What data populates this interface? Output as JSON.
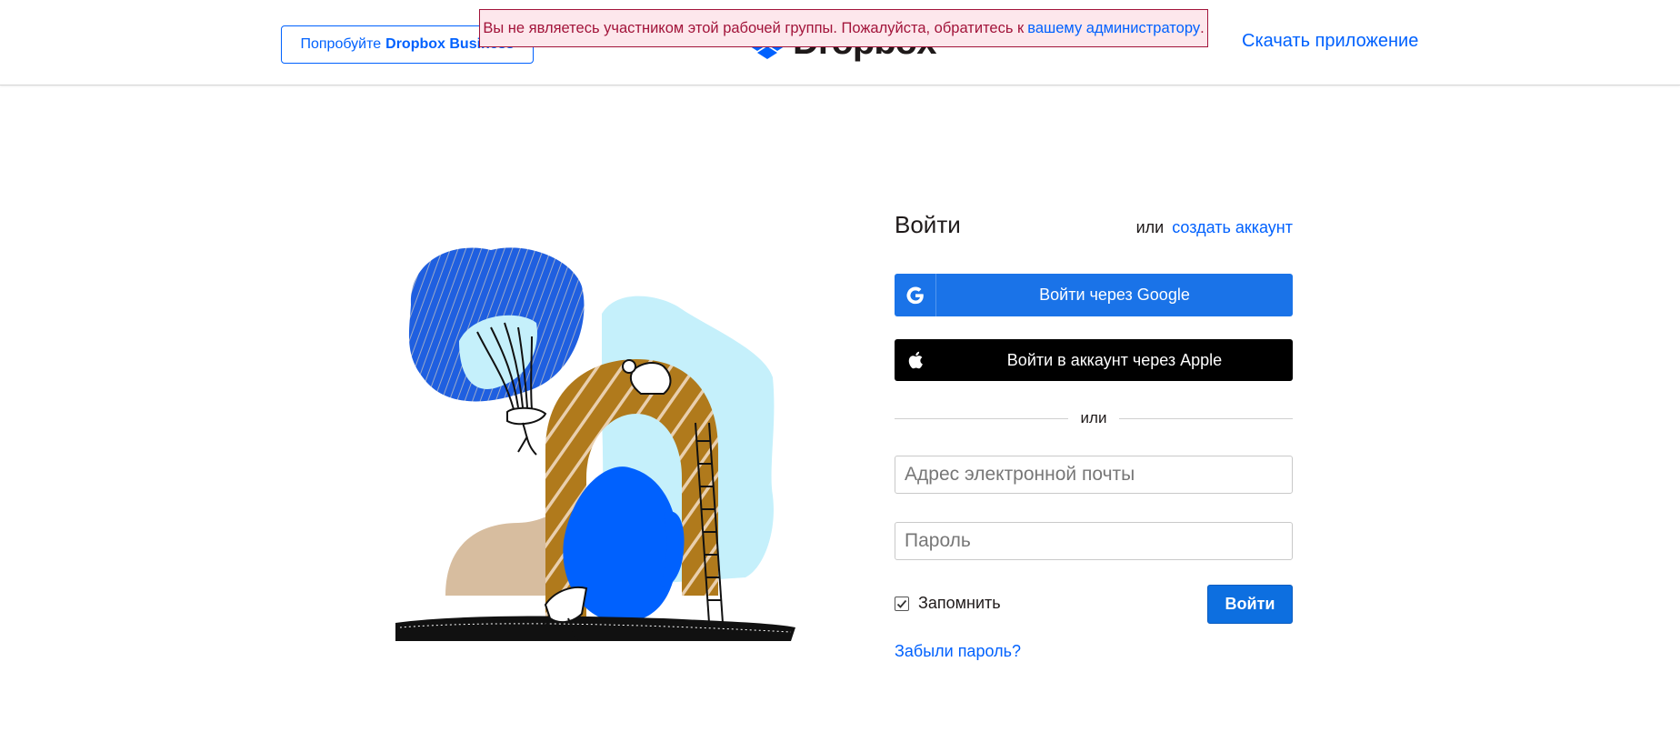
{
  "header": {
    "try_business_prefix": "Попробуйте",
    "try_business_brand": "Dropbox Business",
    "logo_text": "Dropbox",
    "download_app": "Скачать приложение"
  },
  "alert": {
    "message": "Вы не являетесь участником этой рабочей группы. Пожалуйста, обратитесь к",
    "link": "вашему администратору",
    "end": "."
  },
  "login": {
    "title": "Войти",
    "or_text": "или",
    "create_account": "создать аккаунт",
    "google_button": "Войти через Google",
    "apple_button": "Войти в аккаунт через Apple",
    "divider_text": "или",
    "email_placeholder": "Адрес электронной почты",
    "password_placeholder": "Пароль",
    "remember_label": "Запомнить",
    "remember_checked": true,
    "submit_button": "Войти",
    "forgot_password": "Забыли пароль?"
  },
  "colors": {
    "brand_blue": "#0061fe",
    "google_blue": "#1a73e8",
    "alert_red": "#a2143a",
    "alert_bg": "#fde7ec"
  },
  "icons": {
    "google": "google-g-icon",
    "apple": "apple-logo-icon",
    "checkbox": "checkmark-icon",
    "logo": "dropbox-logo-icon"
  }
}
